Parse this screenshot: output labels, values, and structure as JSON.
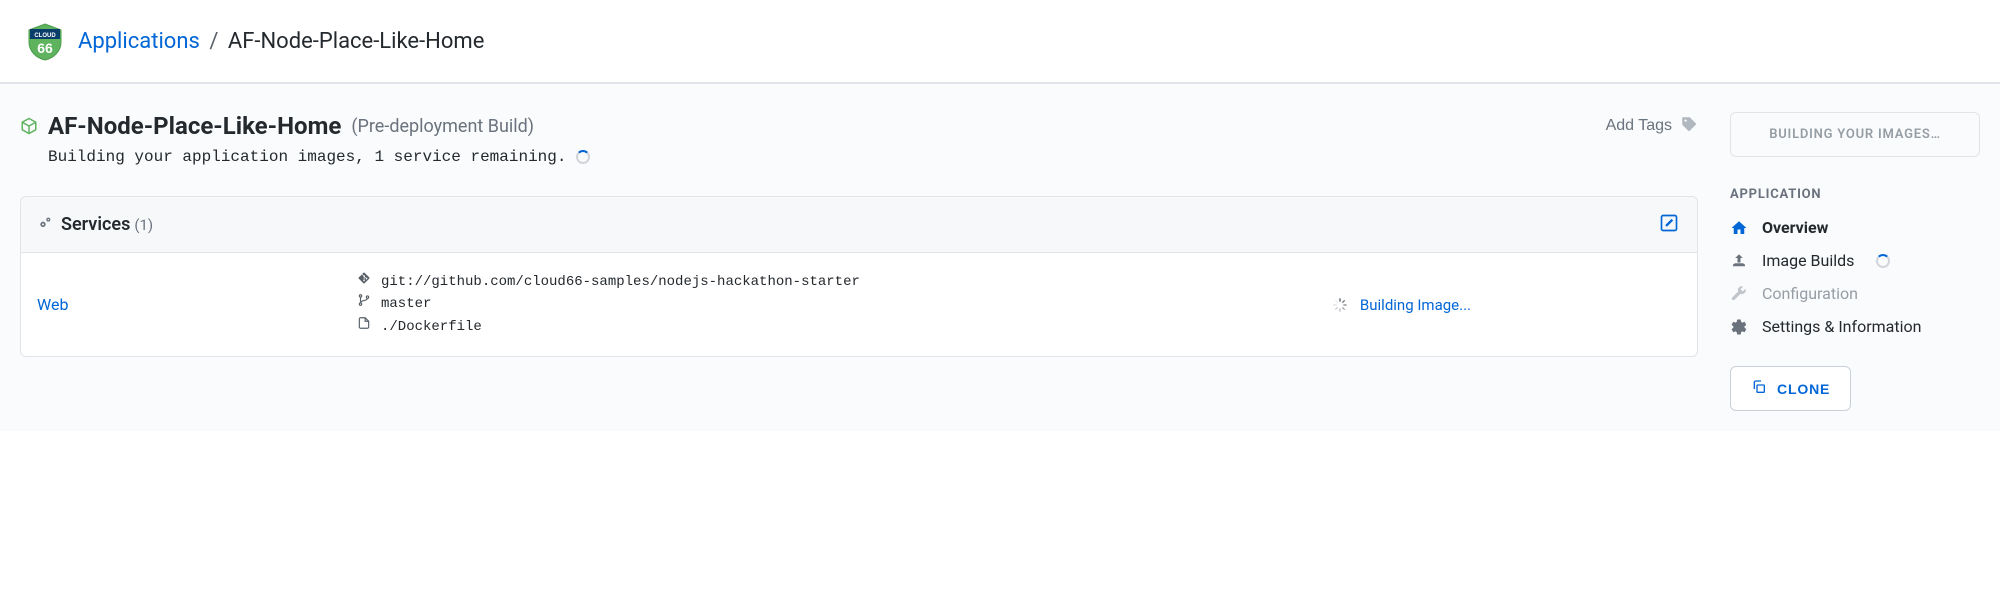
{
  "breadcrumb": {
    "root_label": "Applications",
    "current": "AF-Node-Place-Like-Home"
  },
  "app": {
    "name": "AF-Node-Place-Like-Home",
    "stage": "(Pre-deployment Build)",
    "status_text": "Building your application images, 1 service remaining.",
    "add_tags_label": "Add Tags"
  },
  "services_panel": {
    "title": "Services",
    "count": "(1)"
  },
  "service": {
    "name": "Web",
    "repo": "git://github.com/cloud66-samples/nodejs-hackathon-starter",
    "branch": "master",
    "dockerfile": "./Dockerfile",
    "status": "Building Image..."
  },
  "sidebar": {
    "building_label": "BUILDING YOUR IMAGES…",
    "heading": "APPLICATION",
    "items": [
      {
        "label": "Overview"
      },
      {
        "label": "Image Builds"
      },
      {
        "label": "Configuration"
      },
      {
        "label": "Settings & Information"
      }
    ],
    "clone_label": "CLONE"
  }
}
